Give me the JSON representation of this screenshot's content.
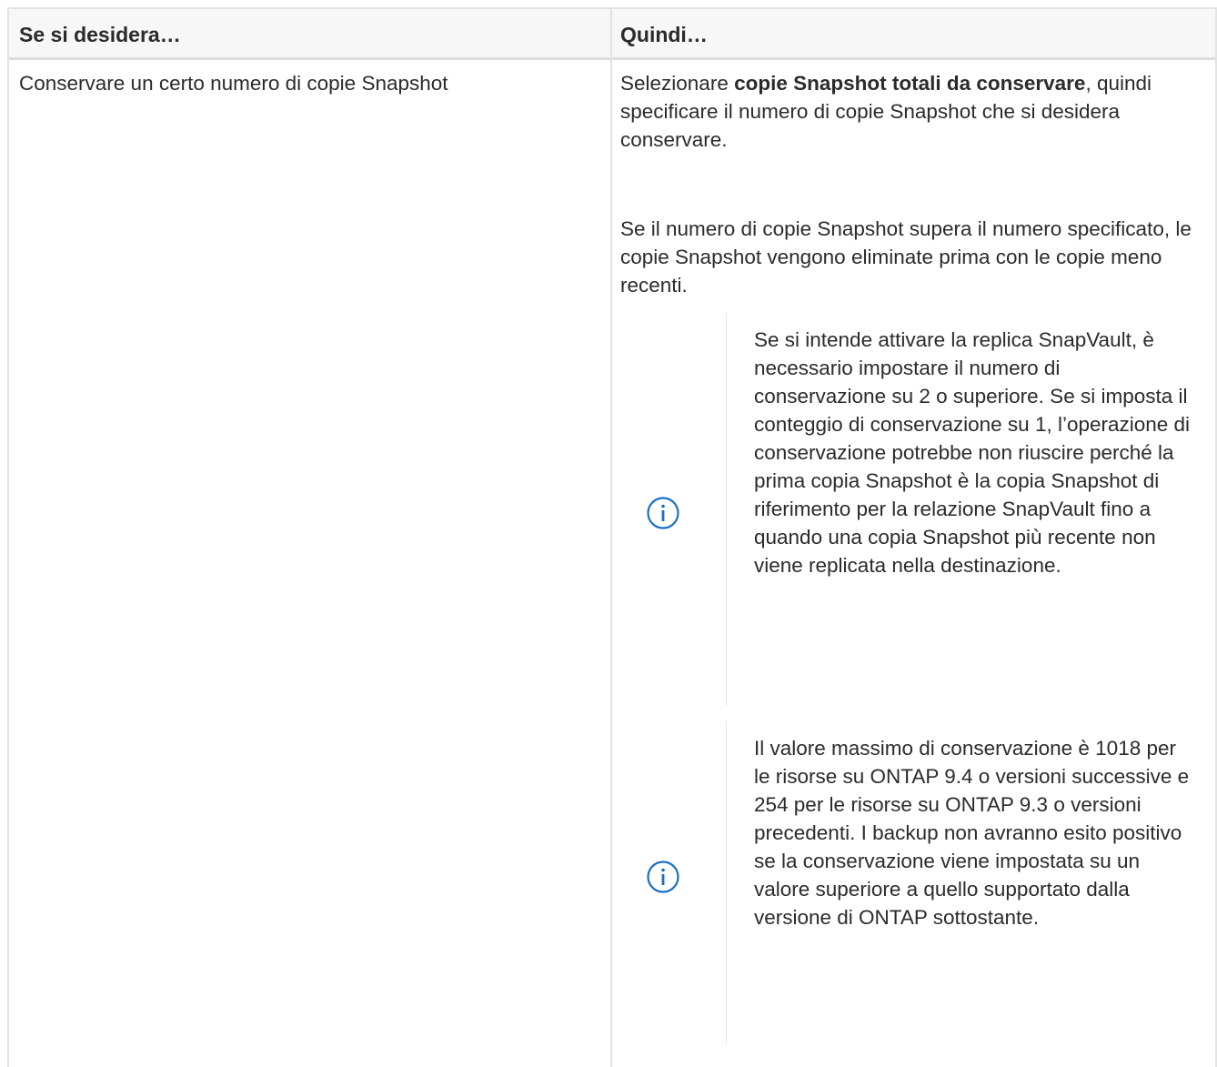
{
  "table": {
    "header": {
      "col1": "Se si desidera…",
      "col2": "Quindi…"
    },
    "row": {
      "condition": "Conservare un certo numero di copie Snapshot",
      "action_intro_prefix": "Selezionare ",
      "action_intro_bold": "copie Snapshot totali da conservare",
      "action_intro_suffix": ", quindi specificare il numero di copie Snapshot che si desidera conservare.",
      "action_detail": "Se il numero di copie Snapshot supera il numero specificato, le copie Snapshot vengono eliminate prima con le copie meno recenti.",
      "notes": [
        {
          "icon": "info-icon",
          "text": "Se si intende attivare la replica SnapVault, è necessario impostare il numero di conservazione su 2 o superiore. Se si imposta il conteggio di conservazione su 1, l’operazione di conservazione potrebbe non riuscire perché la prima copia Snapshot è la copia Snapshot di riferimento per la relazione SnapVault fino a quando una copia Snapshot più recente non viene replicata nella destinazione."
        },
        {
          "icon": "info-icon",
          "text": "Il valore massimo di conservazione è 1018 per le risorse su ONTAP 9.4 o versioni successive e 254 per le risorse su ONTAP 9.3 o versioni precedenti. I backup non avranno esito positivo se la conservazione viene impostata su un valore superiore a quello supportato dalla versione di ONTAP sottostante."
        }
      ]
    }
  },
  "colors": {
    "info_icon": "#1a6fc4",
    "border": "#e3e3e3",
    "header_bg": "#f7f7f7",
    "text": "#2b2b2b"
  }
}
